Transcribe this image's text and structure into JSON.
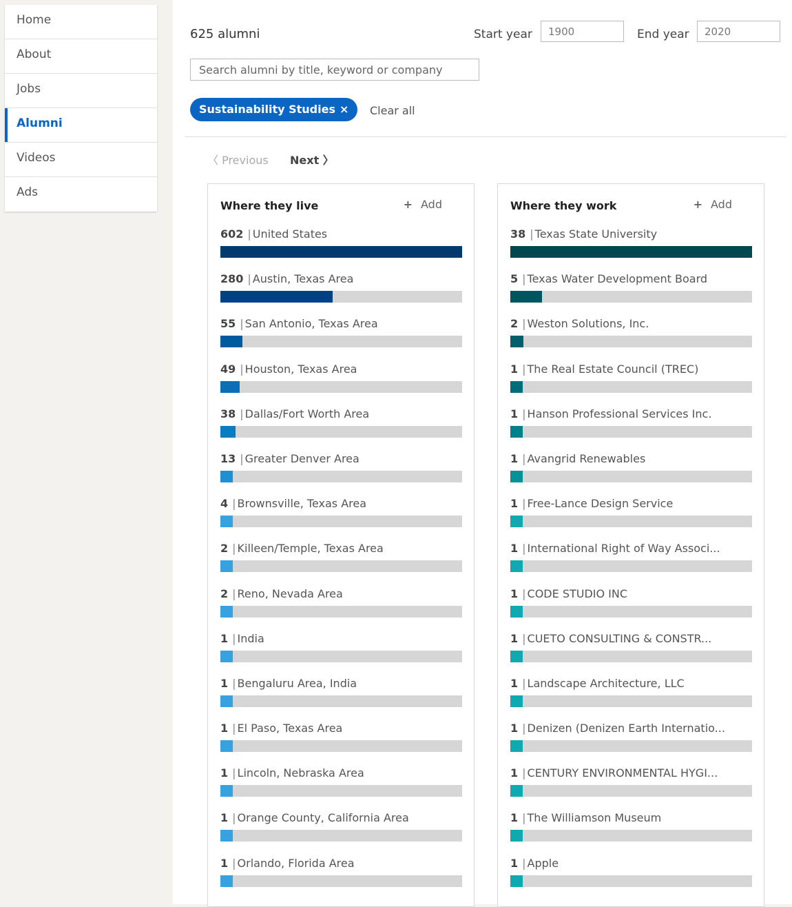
{
  "nav": {
    "items": [
      {
        "label": "Home",
        "active": false
      },
      {
        "label": "About",
        "active": false
      },
      {
        "label": "Jobs",
        "active": false
      },
      {
        "label": "Alumni",
        "active": true
      },
      {
        "label": "Videos",
        "active": false
      },
      {
        "label": "Ads",
        "active": false
      }
    ]
  },
  "header": {
    "count": "625 alumni",
    "start_year_label": "Start year",
    "start_year_value": "1900",
    "end_year_label": "End year",
    "end_year_value": "2020",
    "search_placeholder": "Search alumni by title, keyword or company",
    "filter_pill": "Sustainability Studies",
    "filter_close": "×",
    "clear_all": "Clear all"
  },
  "pager": {
    "previous": "〈 Previous",
    "next": "Next 〉"
  },
  "colors": {
    "accent": "#0a66c2",
    "bar_track": "#d6d6d6"
  },
  "cards": [
    {
      "title": "Where they live",
      "add_label": "Add",
      "rows": [
        {
          "count": "602",
          "label": "United States",
          "fill": 1.0,
          "color": "#003a6f"
        },
        {
          "count": "280",
          "label": "Austin, Texas Area",
          "fill": 0.465,
          "color": "#004182"
        },
        {
          "count": "55",
          "label": "San Antonio, Texas Area",
          "fill": 0.091,
          "color": "#005a9e"
        },
        {
          "count": "49",
          "label": "Houston, Texas Area",
          "fill": 0.081,
          "color": "#0a6fb5"
        },
        {
          "count": "38",
          "label": "Dallas/Fort Worth Area",
          "fill": 0.063,
          "color": "#0a7cc2"
        },
        {
          "count": "13",
          "label": "Greater Denver Area",
          "fill": 0.05,
          "color": "#1d8fd3"
        },
        {
          "count": "4",
          "label": "Brownsville, Texas Area",
          "fill": 0.05,
          "color": "#36a3e0"
        },
        {
          "count": "2",
          "label": "Killeen/Temple, Texas Area",
          "fill": 0.05,
          "color": "#36a3e0"
        },
        {
          "count": "2",
          "label": "Reno, Nevada Area",
          "fill": 0.05,
          "color": "#36a3e0"
        },
        {
          "count": "1",
          "label": "India",
          "fill": 0.05,
          "color": "#36a3e0"
        },
        {
          "count": "1",
          "label": "Bengaluru Area, India",
          "fill": 0.05,
          "color": "#36a3e0"
        },
        {
          "count": "1",
          "label": "El Paso, Texas Area",
          "fill": 0.05,
          "color": "#36a3e0"
        },
        {
          "count": "1",
          "label": "Lincoln, Nebraska Area",
          "fill": 0.05,
          "color": "#36a3e0"
        },
        {
          "count": "1",
          "label": "Orange County, California Area",
          "fill": 0.05,
          "color": "#36a3e0"
        },
        {
          "count": "1",
          "label": "Orlando, Florida Area",
          "fill": 0.05,
          "color": "#36a3e0"
        }
      ]
    },
    {
      "title": "Where they work",
      "add_label": "Add",
      "rows": [
        {
          "count": "38",
          "label": "Texas State University",
          "fill": 1.0,
          "color": "#00474f"
        },
        {
          "count": "5",
          "label": "Texas Water Development Board",
          "fill": 0.132,
          "color": "#00555e"
        },
        {
          "count": "2",
          "label": "Weston Solutions, Inc.",
          "fill": 0.053,
          "color": "#005f6b"
        },
        {
          "count": "1",
          "label": "The Real Estate Council (TREC)",
          "fill": 0.05,
          "color": "#006e7a"
        },
        {
          "count": "1",
          "label": "Hanson Professional Services Inc.",
          "fill": 0.05,
          "color": "#00808a"
        },
        {
          "count": "1",
          "label": "Avangrid Renewables",
          "fill": 0.05,
          "color": "#069199"
        },
        {
          "count": "1",
          "label": "Free-Lance Design Service",
          "fill": 0.05,
          "color": "#12a8b0"
        },
        {
          "count": "1",
          "label": "International Right of Way Associ...",
          "fill": 0.05,
          "color": "#12a8b0"
        },
        {
          "count": "1",
          "label": "CODE STUDIO INC",
          "fill": 0.05,
          "color": "#12a8b0"
        },
        {
          "count": "1",
          "label": "CUETO CONSULTING & CONSTR...",
          "fill": 0.05,
          "color": "#12a8b0"
        },
        {
          "count": "1",
          "label": "Landscape Architecture, LLC",
          "fill": 0.05,
          "color": "#12a8b0"
        },
        {
          "count": "1",
          "label": "Denizen (Denizen Earth Internatio...",
          "fill": 0.05,
          "color": "#12a8b0"
        },
        {
          "count": "1",
          "label": "CENTURY ENVIRONMENTAL HYGI...",
          "fill": 0.05,
          "color": "#12a8b0"
        },
        {
          "count": "1",
          "label": "The Williamson Museum",
          "fill": 0.05,
          "color": "#12a8b0"
        },
        {
          "count": "1",
          "label": "Apple",
          "fill": 0.05,
          "color": "#12a8b0"
        }
      ]
    }
  ]
}
